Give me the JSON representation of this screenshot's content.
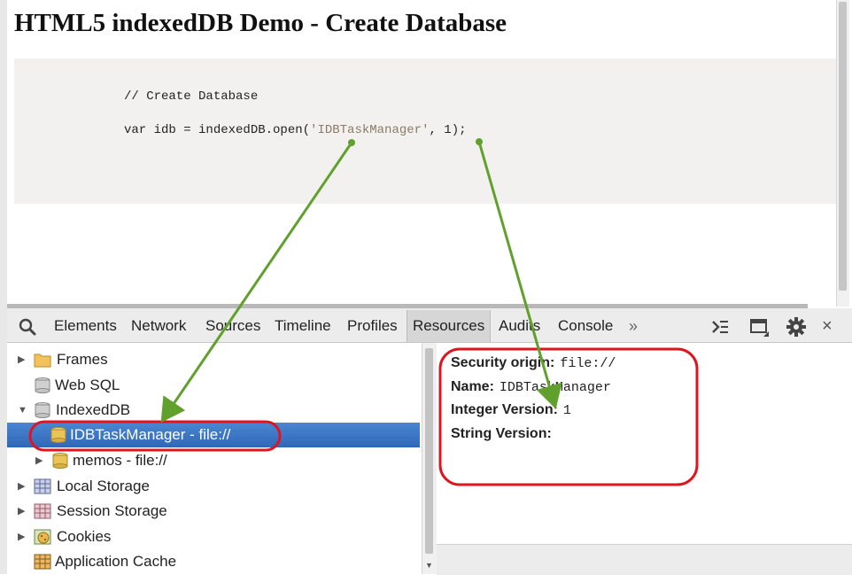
{
  "page": {
    "title": "HTML5 indexedDB Demo - Create Database",
    "code": {
      "comment": "// Create Database",
      "line_prefix": "var idb = indexedDB.open(",
      "db_name_literal": "'IDBTaskManager'",
      "line_mid": ", ",
      "version_literal": "1",
      "line_suffix": ");"
    }
  },
  "devtools": {
    "tabs": [
      "Elements",
      "Network",
      "Sources",
      "Timeline",
      "Profiles",
      "Resources",
      "Audits",
      "Console"
    ],
    "active_tab": "Resources",
    "overflow": "»",
    "close": "×",
    "icons": [
      "search-icon",
      "console-drawer-icon",
      "dock-icon",
      "settings-gear-icon",
      "close-icon"
    ],
    "tree": [
      {
        "label": "Frames",
        "icon": "folder-icon",
        "expandable": true
      },
      {
        "label": "Web SQL",
        "icon": "database-icon",
        "expandable": false
      },
      {
        "label": "IndexedDB",
        "icon": "database-icon",
        "expanded": true
      },
      {
        "label": "IDBTaskManager - file://",
        "icon": "database-icon",
        "selected": true
      },
      {
        "label": "memos - file://",
        "icon": "database-icon",
        "expandable": true
      },
      {
        "label": "Local Storage",
        "icon": "table-icon",
        "expandable": true
      },
      {
        "label": "Session Storage",
        "icon": "table-icon",
        "expandable": true
      },
      {
        "label": "Cookies",
        "icon": "cookie-icon",
        "expandable": true
      },
      {
        "label": "Application Cache",
        "icon": "grid-icon",
        "expandable": false
      }
    ],
    "details": [
      {
        "key": "Security origin:",
        "value": "file://"
      },
      {
        "key": "Name:",
        "value": "IDBTaskManager"
      },
      {
        "key": "Integer Version:",
        "value": "1"
      },
      {
        "key": "String Version:",
        "value": ""
      }
    ]
  },
  "annotations": {
    "highlight_color": "#e0141e",
    "arrow_color": "#5fa12c"
  }
}
